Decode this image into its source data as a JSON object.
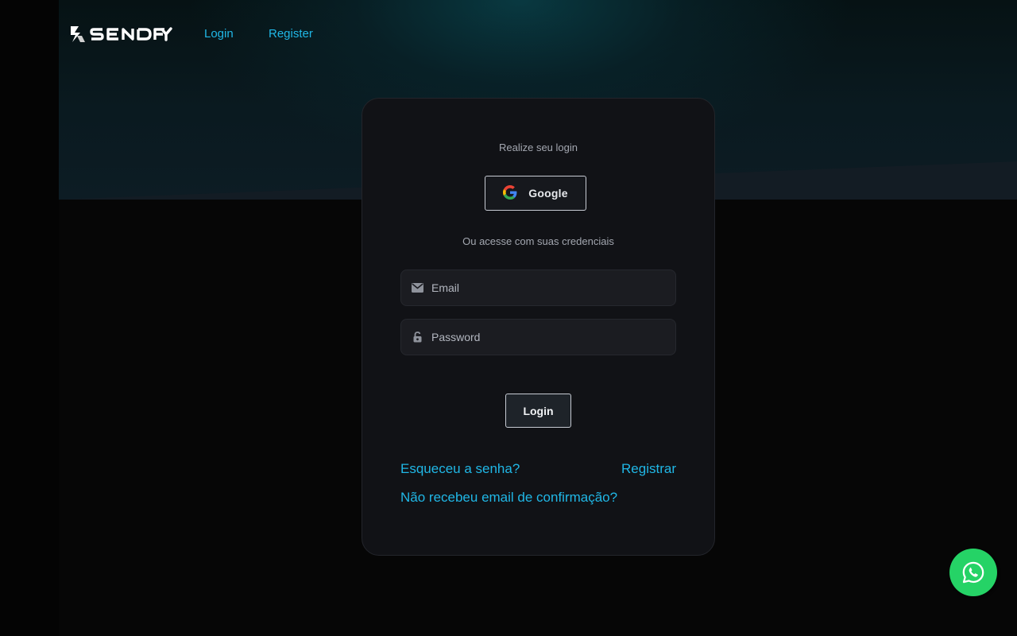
{
  "nav": {
    "logo_text": "SENDFY",
    "login_label": "Login",
    "register_label": "Register"
  },
  "card": {
    "title": "Realize seu login",
    "google_label": "Google",
    "divider_text": "Ou acesse com suas credenciais",
    "email_placeholder": "Email",
    "password_placeholder": "Password",
    "login_button": "Login",
    "forgot_link": "Esqueceu a senha?",
    "register_link": "Registrar",
    "resend_link": "Não recebeu email de confirmação?"
  },
  "icons": {
    "email": "envelope-icon",
    "password": "lock-icon",
    "google": "google-icon",
    "whatsapp": "whatsapp-icon"
  },
  "colors": {
    "accent": "#20b7e6",
    "whatsapp": "#25d366",
    "card_bg": "#111216",
    "page_bg": "#060606"
  }
}
